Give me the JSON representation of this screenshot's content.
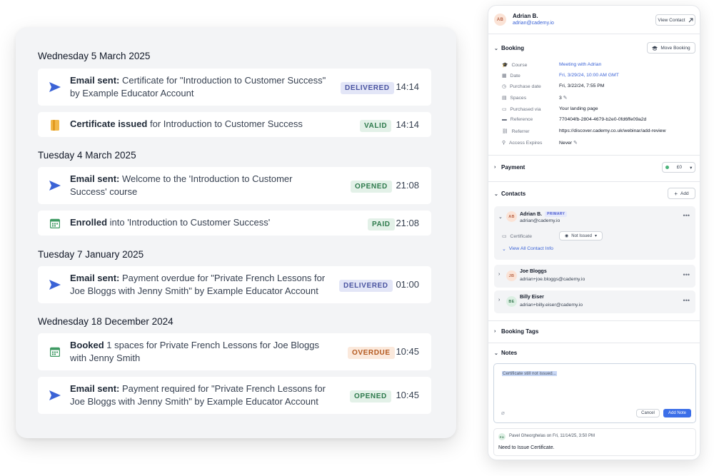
{
  "activity": {
    "days": [
      {
        "date": "Wednesday 5 March 2025",
        "events": [
          {
            "icon": "send-icon",
            "bold": "Email sent:",
            "text": " Certificate for \"Introduction to Customer Success\" by Example Educator Account",
            "status": "DELIVERED",
            "time": "14:14"
          },
          {
            "icon": "certificate-icon",
            "bold": "Certificate issued",
            "text": " for Introduction to Customer Success",
            "status": "VALID",
            "time": "14:14"
          }
        ]
      },
      {
        "date": "Tuesday 4 March 2025",
        "events": [
          {
            "icon": "send-icon",
            "bold": "Email sent:",
            "text": " Welcome to the 'Introduction to Customer Success' course",
            "status": "OPENED",
            "time": "21:08"
          },
          {
            "icon": "calendar-icon",
            "bold": "Enrolled",
            "text": " into 'Introduction to Customer Success'",
            "status": "PAID",
            "time": "21:08"
          }
        ]
      },
      {
        "date": "Tuesday 7 January 2025",
        "events": [
          {
            "icon": "send-icon",
            "bold": "Email sent:",
            "text": " Payment overdue for \"Private French Lessons for Joe Bloggs with Jenny Smith\" by Example Educator Account",
            "status": "DELIVERED",
            "time": "01:00"
          }
        ]
      },
      {
        "date": "Wednesday 18 December 2024",
        "events": [
          {
            "icon": "calendar-icon",
            "bold": "Booked",
            "text": " 1 spaces for Private French Lessons for Joe Bloggs with Jenny Smith",
            "status": "OVERDUE",
            "time": "10:45"
          },
          {
            "icon": "send-icon",
            "bold": "Email sent:",
            "text": " Payment required for \"Private French Lessons for Joe Bloggs with Jenny Smith\" by Example Educator Account",
            "status": "OPENED",
            "time": "10:45"
          }
        ]
      }
    ]
  },
  "panel": {
    "contact": {
      "initials": "AB",
      "name": "Adrian B.",
      "email": "adrian@cademy.io",
      "view_label": "View Contact"
    },
    "booking": {
      "title": "Booking",
      "move_label": "Move Booking",
      "fields": [
        {
          "icon": "graduation-cap-icon",
          "label": "Course",
          "value": "Meeting with Adrian",
          "link": true
        },
        {
          "icon": "calendar-icon",
          "label": "Date",
          "value": "Fri, 3/29/24, 10:00 AM GMT",
          "link": true
        },
        {
          "icon": "clock-icon",
          "label": "Purchase date",
          "value": "Fri, 3/22/24, 7:55 PM",
          "link": false
        },
        {
          "icon": "grid-icon",
          "label": "Spaces",
          "value": "3",
          "link": false
        },
        {
          "icon": "window-icon",
          "label": "Purchased via",
          "value": "Your landing page",
          "link": false
        },
        {
          "icon": "card-icon",
          "label": "Reference",
          "value": "770404fb-2804-4679-b2e0-0fd6ffe09a2d",
          "link": false
        },
        {
          "icon": "link-icon",
          "label": "Referrer",
          "value": "https://discover.cademy.co.uk/webinar/add-review",
          "link": false
        },
        {
          "icon": "walk-icon",
          "label": "Access Expires",
          "value": "Never",
          "link": false
        }
      ]
    },
    "payment": {
      "title": "Payment",
      "amount": "£0"
    },
    "contacts": {
      "title": "Contacts",
      "add_label": "Add",
      "items": [
        {
          "initials": "AB",
          "name": "Adrian B.",
          "badge": "PRIMARY",
          "email": "adrian@cademy.io"
        },
        {
          "initials": "JB",
          "name": "Joe Bloggs",
          "email": "adrian+joe.bloggs@cademy.io"
        },
        {
          "initials": "BE",
          "name": "Billy Eiser",
          "email": "adrian+billy.eiser@cademy.io"
        }
      ],
      "certificate_label": "Certificate",
      "certificate_value": "Not Issued",
      "view_all": "View All Contact Info"
    },
    "booking_tags": {
      "title": "Booking Tags"
    },
    "notes": {
      "title": "Notes",
      "draft": "Certificate still not issued...",
      "cancel_label": "Cancel",
      "add_label": "Add Note",
      "entry": {
        "initials": "PG",
        "meta": "Pavel Gheorghelas on Fri, 11/14/25, 3:50 PM",
        "body": "Need to Issue Certificate."
      }
    }
  }
}
